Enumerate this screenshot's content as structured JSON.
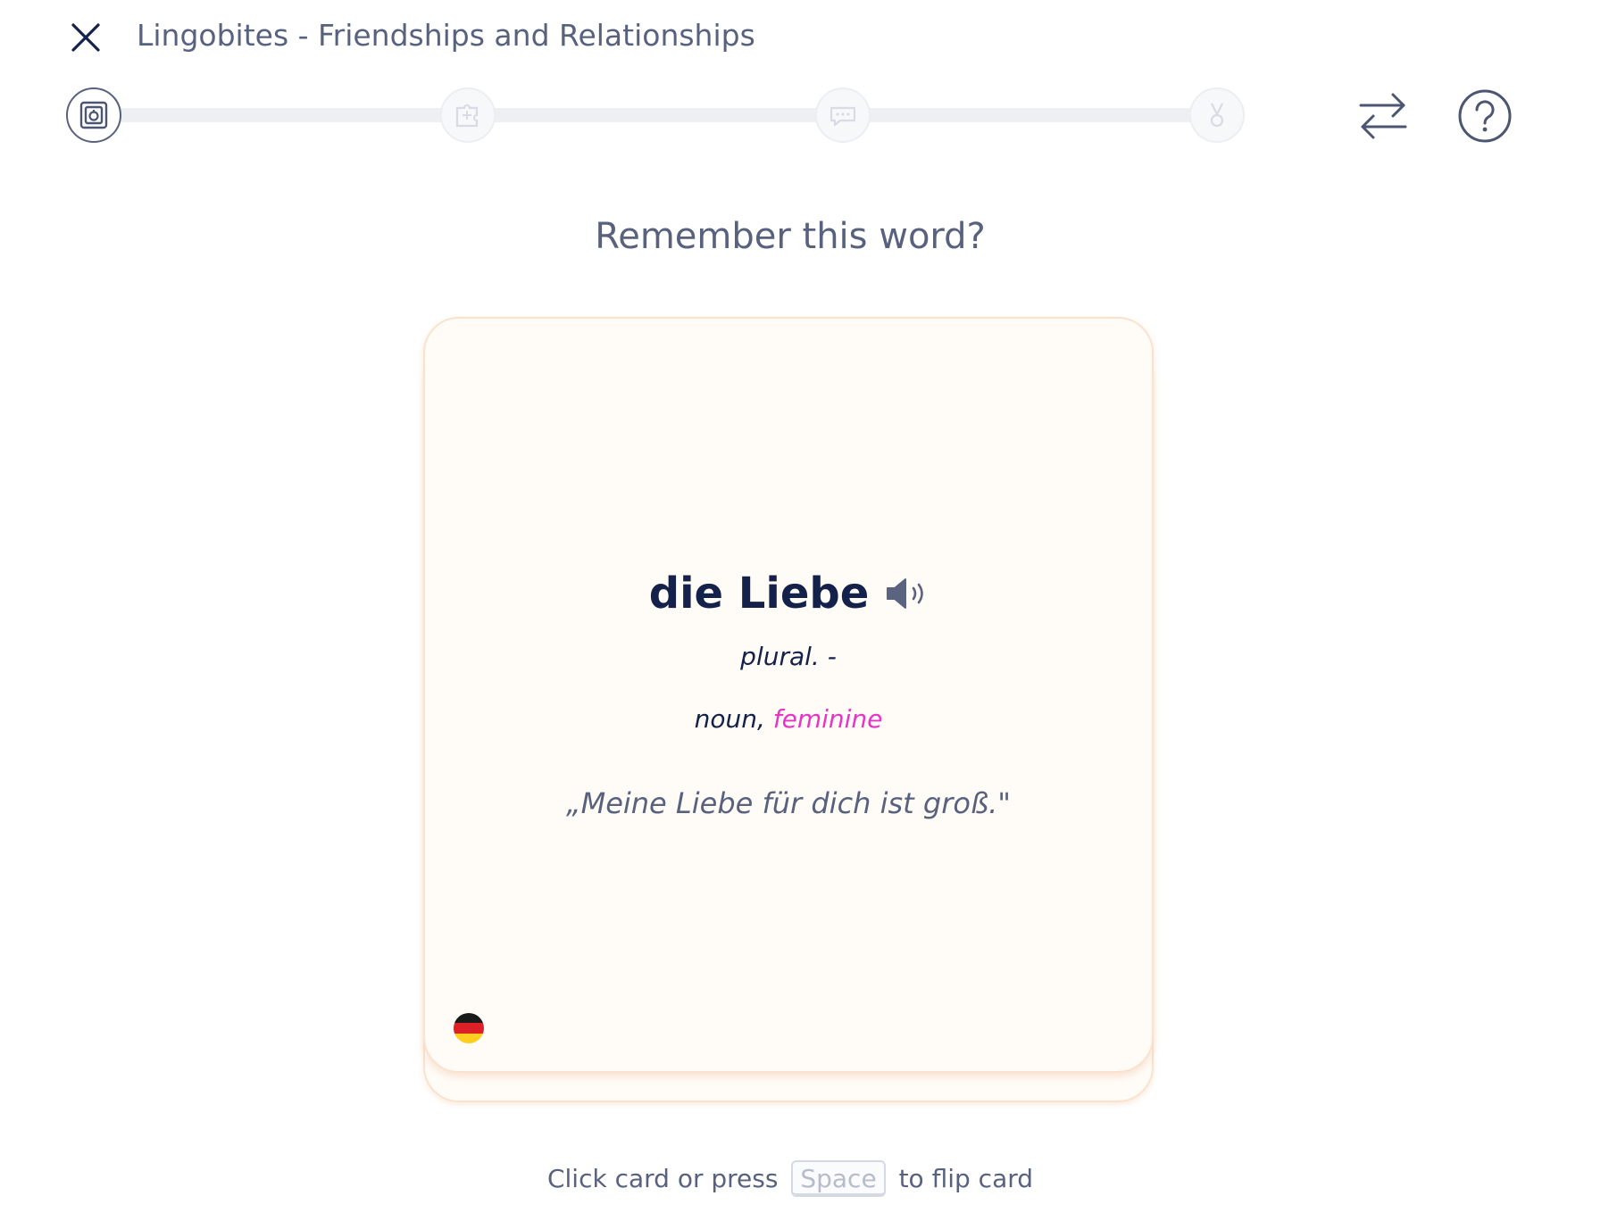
{
  "header": {
    "title": "Lingobites - Friendships and Relationships",
    "close_icon": "close-icon",
    "swap_icon": "swap-arrows-icon",
    "help_icon": "question-circle-icon"
  },
  "progress": {
    "steps": [
      {
        "icon": "flashcard-icon",
        "state": "active"
      },
      {
        "icon": "puzzle-icon",
        "state": "pending"
      },
      {
        "icon": "chat-bubble-icon",
        "state": "pending"
      },
      {
        "icon": "medal-icon",
        "state": "pending"
      }
    ],
    "completed_fraction": 0
  },
  "prompt": "Remember this word?",
  "card": {
    "word": "die Liebe",
    "speaker_icon": "speaker-icon",
    "plural": "plural. -",
    "part_of_speech": "noun",
    "separator": ",",
    "gender": "feminine",
    "example": "„Meine Liebe für dich ist groß.\"",
    "language_flag": "germany-flag-icon"
  },
  "hint": {
    "before": "Click card or press",
    "key": "Space",
    "after": "to flip card"
  },
  "colors": {
    "text_primary": "#14214a",
    "text_secondary": "#58627f",
    "gender_feminine": "#e833c7",
    "card_background": "#fffbf6",
    "card_border": "#fbe2cd"
  }
}
